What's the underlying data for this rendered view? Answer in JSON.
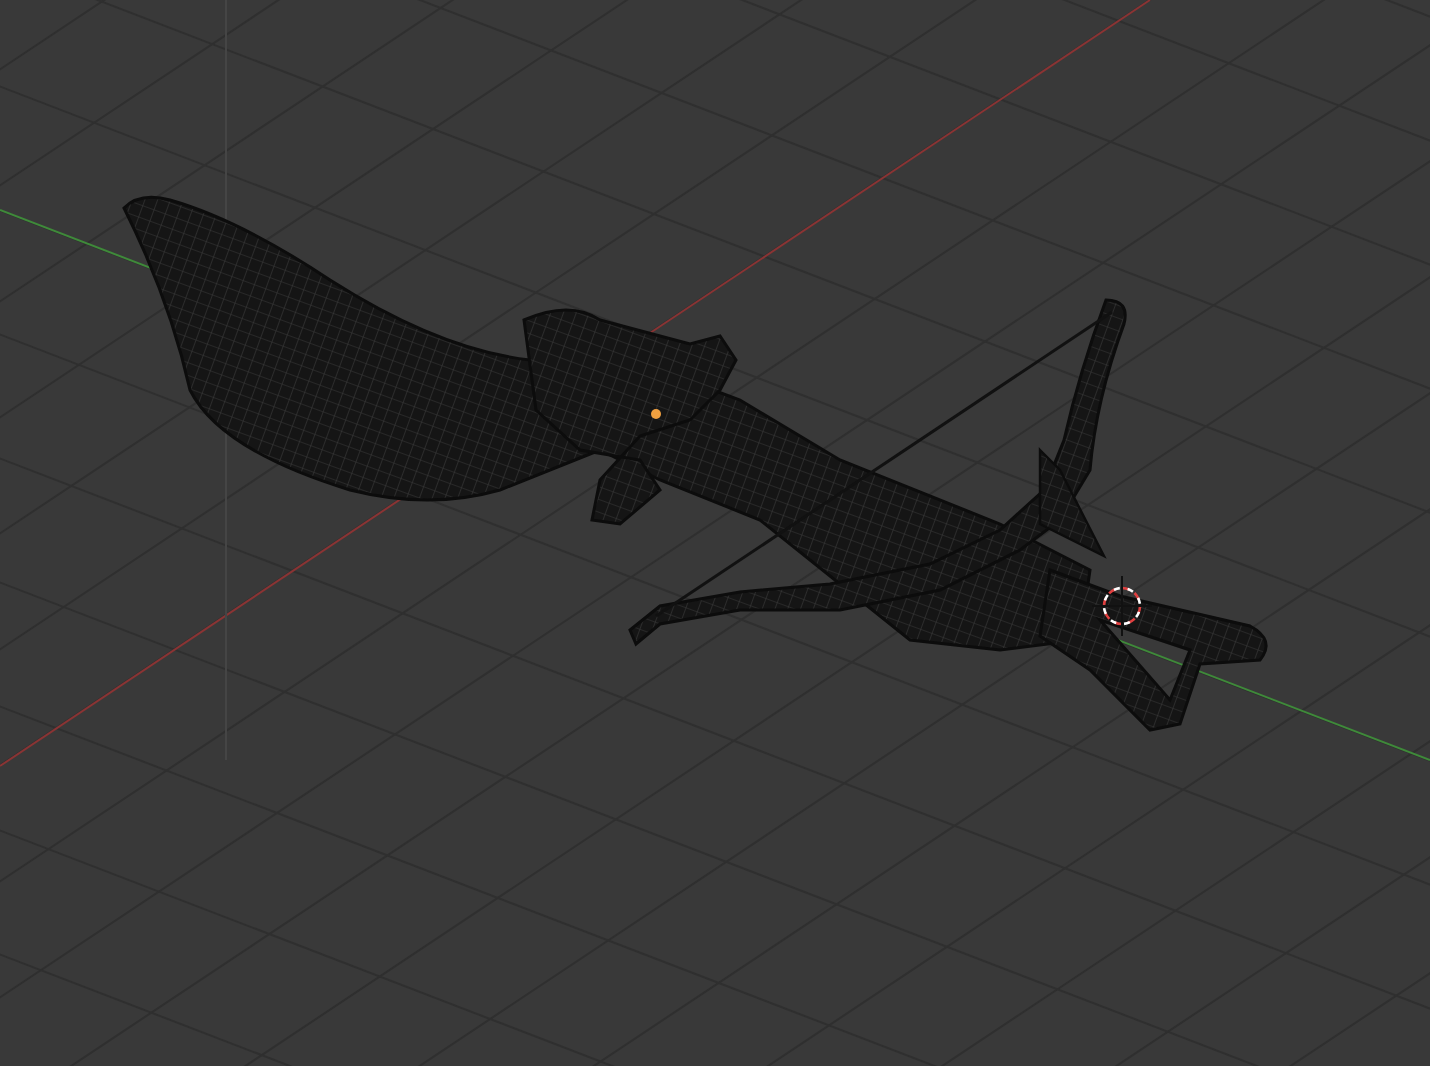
{
  "viewport": {
    "grid_visible": true,
    "axes_visible": true,
    "origin_marker": true,
    "cursor_3d": true
  }
}
